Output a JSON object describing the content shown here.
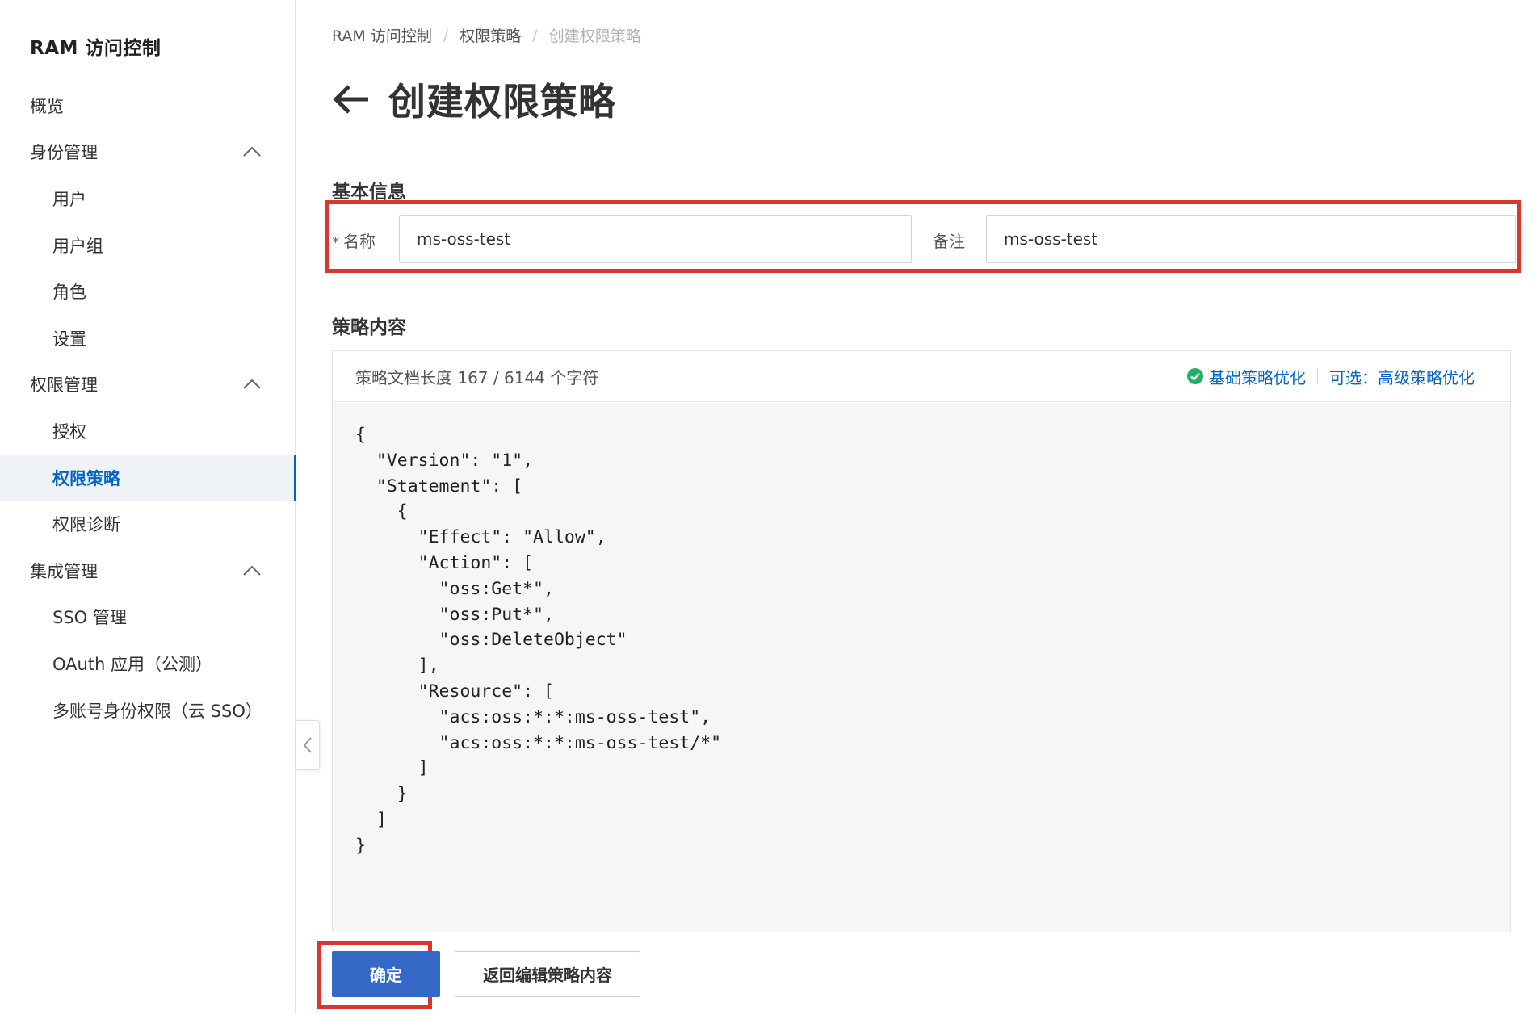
{
  "sidebar": {
    "title": "RAM 访问控制",
    "items": [
      {
        "label": "概览",
        "level": 0
      },
      {
        "label": "身份管理",
        "level": 0,
        "expanded": true
      },
      {
        "label": "用户",
        "level": 1
      },
      {
        "label": "用户组",
        "level": 1
      },
      {
        "label": "角色",
        "level": 1
      },
      {
        "label": "设置",
        "level": 1
      },
      {
        "label": "权限管理",
        "level": 0,
        "expanded": true
      },
      {
        "label": "授权",
        "level": 1
      },
      {
        "label": "权限策略",
        "level": 1,
        "active": true
      },
      {
        "label": "权限诊断",
        "level": 1
      },
      {
        "label": "集成管理",
        "level": 0,
        "expanded": true
      },
      {
        "label": "SSO 管理",
        "level": 1
      },
      {
        "label": "OAuth 应用（公测）",
        "level": 1
      },
      {
        "label": "多账号身份权限（云 SSO）",
        "level": 1
      }
    ]
  },
  "breadcrumb": [
    "RAM 访问控制",
    "权限策略",
    "创建权限策略"
  ],
  "page": {
    "title": "创建权限策略"
  },
  "basic_info": {
    "title": "基本信息",
    "name_label": "名称",
    "required_mark": "*",
    "name_value": "ms-oss-test",
    "remark_label": "备注",
    "remark_value": "ms-oss-test"
  },
  "policy": {
    "title": "策略内容",
    "doc_length": "策略文档长度 167 / 6144 个字符",
    "basic_optimize": "基础策略优化",
    "advanced_optimize": "可选：高级策略优化",
    "code": "{\n  \"Version\": \"1\",\n  \"Statement\": [\n    {\n      \"Effect\": \"Allow\",\n      \"Action\": [\n        \"oss:Get*\",\n        \"oss:Put*\",\n        \"oss:DeleteObject\"\n      ],\n      \"Resource\": [\n        \"acs:oss:*:*:ms-oss-test\",\n        \"acs:oss:*:*:ms-oss-test/*\"\n      ]\n    }\n  ]\n}"
  },
  "actions": {
    "confirm": "确定",
    "back_edit": "返回编辑策略内容"
  },
  "colors": {
    "accent": "#0064c8",
    "primary_button": "#3569c8",
    "highlight": "#d8372a",
    "success": "#23b066"
  },
  "icons": {
    "back": "arrow-left-icon",
    "collapse": "chevron-up-icon",
    "sidebar_toggle": "chevron-left-icon",
    "check": "check-circle-icon"
  }
}
